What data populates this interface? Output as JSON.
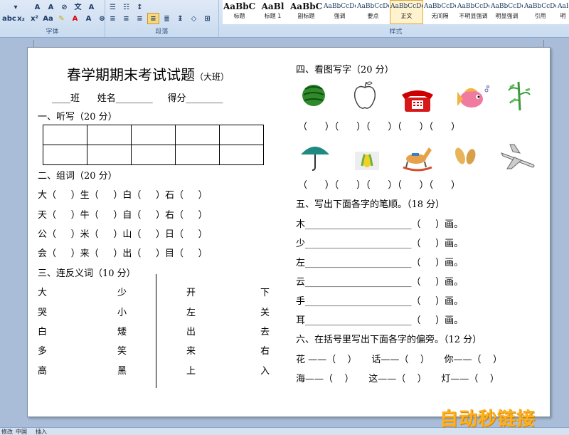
{
  "ribbon": {
    "font_group_label": "字体",
    "paragraph_group_label": "段落",
    "styles_group_label": "样式",
    "styles": [
      {
        "sample": "AaBbC",
        "name": "标题",
        "big": true
      },
      {
        "sample": "AaBl",
        "name": "标题 1",
        "big": true
      },
      {
        "sample": "AaBbC",
        "name": "副标题",
        "big": true
      },
      {
        "sample": "AaBbCcDd",
        "name": "强调"
      },
      {
        "sample": "AaBbCcDd",
        "name": "要点"
      },
      {
        "sample": "AaBbCcDd",
        "name": "正文",
        "selected": true
      },
      {
        "sample": "AaBbCcDd",
        "name": "无间隔"
      },
      {
        "sample": "AaBbCcDd",
        "name": "不明显强调"
      },
      {
        "sample": "AaBbCcDd",
        "name": "明显强调"
      },
      {
        "sample": "AaBbCcDd",
        "name": "引用"
      },
      {
        "sample": "AaBbCcDd",
        "name": "明"
      }
    ]
  },
  "doc": {
    "title": "春学期期末考试试题",
    "title_suffix": "（大班）",
    "info_line": "____班      姓名________     得分________",
    "s1_heading": "一、听写（20 分）",
    "s2_heading": "二、组词（20 分）",
    "s2_rows": [
      "大（     ）生（     ）白（     ）石（     ）",
      "天（     ）牛（     ）自（     ）右（     ）",
      "公（     ）米（     ）山（     ）日（     ）",
      "会（     ）来（     ）出（     ）目（     ）"
    ],
    "s3_heading": "三、连反义词（10 分）",
    "s3_left_a": [
      "大",
      "哭",
      "白",
      "多",
      "高"
    ],
    "s3_left_b": [
      "少",
      "小",
      "矮",
      "笑",
      "黑"
    ],
    "s3_right_a": [
      "开",
      "左",
      "出",
      "来",
      "上"
    ],
    "s3_right_b": [
      "下",
      "关",
      "去",
      "右",
      "入"
    ],
    "s4_heading": "四、看图写字（20 分）",
    "s4_brackets_row1": "（      ）（      ）（      ）（      ）（      ）",
    "s4_brackets_row2": "（      ）（      ）（      ）（      ）（      ）",
    "s5_heading": "五、写出下面各字的笔顺。（18 分）",
    "s5_rows": [
      "木_______________________（     ）画。",
      "少_______________________（     ）画。",
      "左_______________________（     ）画。",
      "云_______________________（     ）画。",
      "手_______________________（     ）画。",
      "耳_______________________（     ）画。"
    ],
    "s6_heading": "六、在括号里写出下面各字的偏旁。（12 分）",
    "s6_row1": "花 ——（    ）     话——（    ）     你——（    ）",
    "s6_row2": "海——（    ）     这——（    ）     灯——（    ）"
  },
  "icons": [
    "watermelon-icon",
    "apple-icon",
    "telephone-icon",
    "fish-icon",
    "bamboo-icon",
    "umbrella-icon",
    "corn-icon",
    "rocking-horse-icon",
    "peanut-icon",
    "airplane-icon"
  ],
  "statusbar": {
    "item1": "修改",
    "item2": "中国",
    "item3": "插入"
  },
  "watermark": "自动秒链接",
  "colors": {
    "ribbon": "#dfe9f6",
    "page": "#ffffff",
    "workspace": "#a9bdd8",
    "watermark": "#ffb01f"
  }
}
